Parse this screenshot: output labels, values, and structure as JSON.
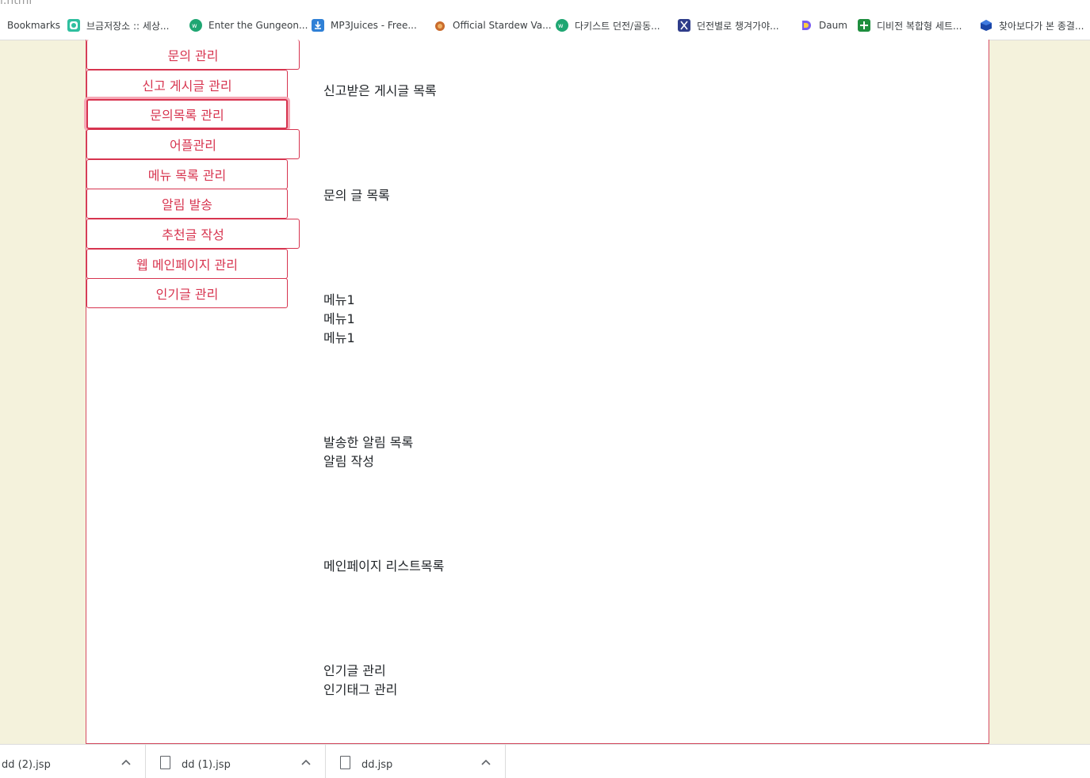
{
  "url_fragment": "l.html",
  "bookmarks": [
    {
      "label": "Bookmarks",
      "icon": "none"
    },
    {
      "label": "브금저장소 :: 세상...",
      "icon": "music-note-icon",
      "color": "#2fbf9f"
    },
    {
      "label": "Enter the Gungeon...",
      "icon": "wiki-icon",
      "color": "#1fa672"
    },
    {
      "label": "MP3Juices - Free...",
      "icon": "download-icon",
      "color": "#2f80d6"
    },
    {
      "label": "Official Stardew Va...",
      "icon": "chicken-icon",
      "color": "#c96b2c"
    },
    {
      "label": "다키스트 던전/골동...",
      "icon": "wiki-icon",
      "color": "#1fa672"
    },
    {
      "label": "던전별로 챙겨가야...",
      "icon": "x-logo-icon",
      "color": "#2f3d8a"
    },
    {
      "label": "Daum",
      "icon": "daum-icon",
      "color": "#7a5cf0"
    },
    {
      "label": "디비전 복합형 세트...",
      "icon": "sheets-plus-icon",
      "color": "#1e8e3e"
    },
    {
      "label": "찾아보다가 본 종결...",
      "icon": "cube-icon",
      "color": "#1a46a8"
    }
  ],
  "sidebar": {
    "items": [
      {
        "label": "문의 관리"
      },
      {
        "label": "신고 게시글 관리"
      },
      {
        "label": "문의목록 관리"
      },
      {
        "label": "어플관리"
      },
      {
        "label": "메뉴 목록 관리"
      },
      {
        "label": "알림 발송"
      },
      {
        "label": "추천글 작성"
      },
      {
        "label": "웹 메인페이지 관리"
      },
      {
        "label": "인기글 관리"
      }
    ]
  },
  "content": {
    "report_list": "신고받은 게시글 목록",
    "inquiry_list": "문의 글 목록",
    "menus": [
      "메뉴1",
      "메뉴1",
      "메뉴1"
    ],
    "sent_alarms": "발송한 알림 목록",
    "write_alarm": "알림 작성",
    "main_page_list": "메인페이지 리스트목록",
    "popular_posts": "인기글 관리",
    "popular_tags": "인기태그 관리"
  },
  "downloads": [
    {
      "name": "dd (2).jsp"
    },
    {
      "name": "dd (1).jsp"
    },
    {
      "name": "dd.jsp"
    }
  ],
  "colors": {
    "accent": "#d7344f",
    "focus_ring": "#f6a9b7",
    "side_bg": "#f4f2dc"
  }
}
